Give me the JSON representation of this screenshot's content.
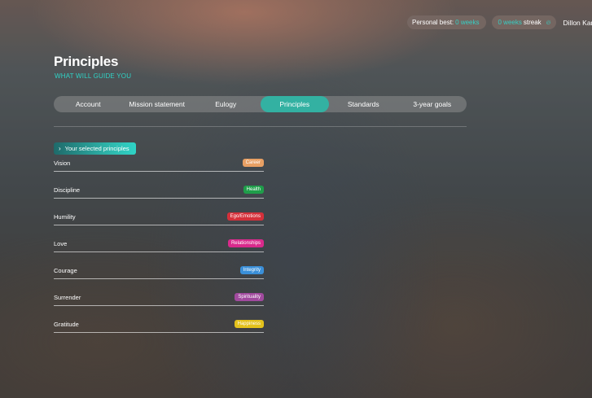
{
  "topbar": {
    "personal_best_label": "Personal best:",
    "personal_best_value": "0 weeks",
    "streak_value": "0 weeks",
    "streak_label": "streak",
    "streak_icon": "flame-icon",
    "username": "Dillon Kanner"
  },
  "header": {
    "title": "Principles",
    "subtitle": "WHAT WILL GUIDE YOU"
  },
  "tabs": [
    {
      "label": "Account",
      "active": false
    },
    {
      "label": "Mission statement",
      "active": false
    },
    {
      "label": "Eulogy",
      "active": false
    },
    {
      "label": "Principles",
      "active": true
    },
    {
      "label": "Standards",
      "active": false
    },
    {
      "label": "3-year goals",
      "active": false
    }
  ],
  "section": {
    "label": "Your selected principles",
    "icon": "chevron-right-icon"
  },
  "principles": [
    {
      "name": "Vision",
      "category": "Career",
      "color": "#e8a064"
    },
    {
      "name": "Discipline",
      "category": "Health",
      "color": "#1f9e4a"
    },
    {
      "name": "Humility",
      "category": "Ego/Emotions",
      "color": "#d4303a"
    },
    {
      "name": "Love",
      "category": "Relationships",
      "color": "#d92a8c"
    },
    {
      "name": "Courage",
      "category": "Integrity",
      "color": "#3a8fd8"
    },
    {
      "name": "Surrender",
      "category": "Spirituality",
      "color": "#a14a9e"
    },
    {
      "name": "Gratitude",
      "category": "Happiness",
      "color": "#e4c21c"
    }
  ],
  "colors": {
    "accent": "#33b1a2",
    "accent_text": "#2fd3c6"
  }
}
